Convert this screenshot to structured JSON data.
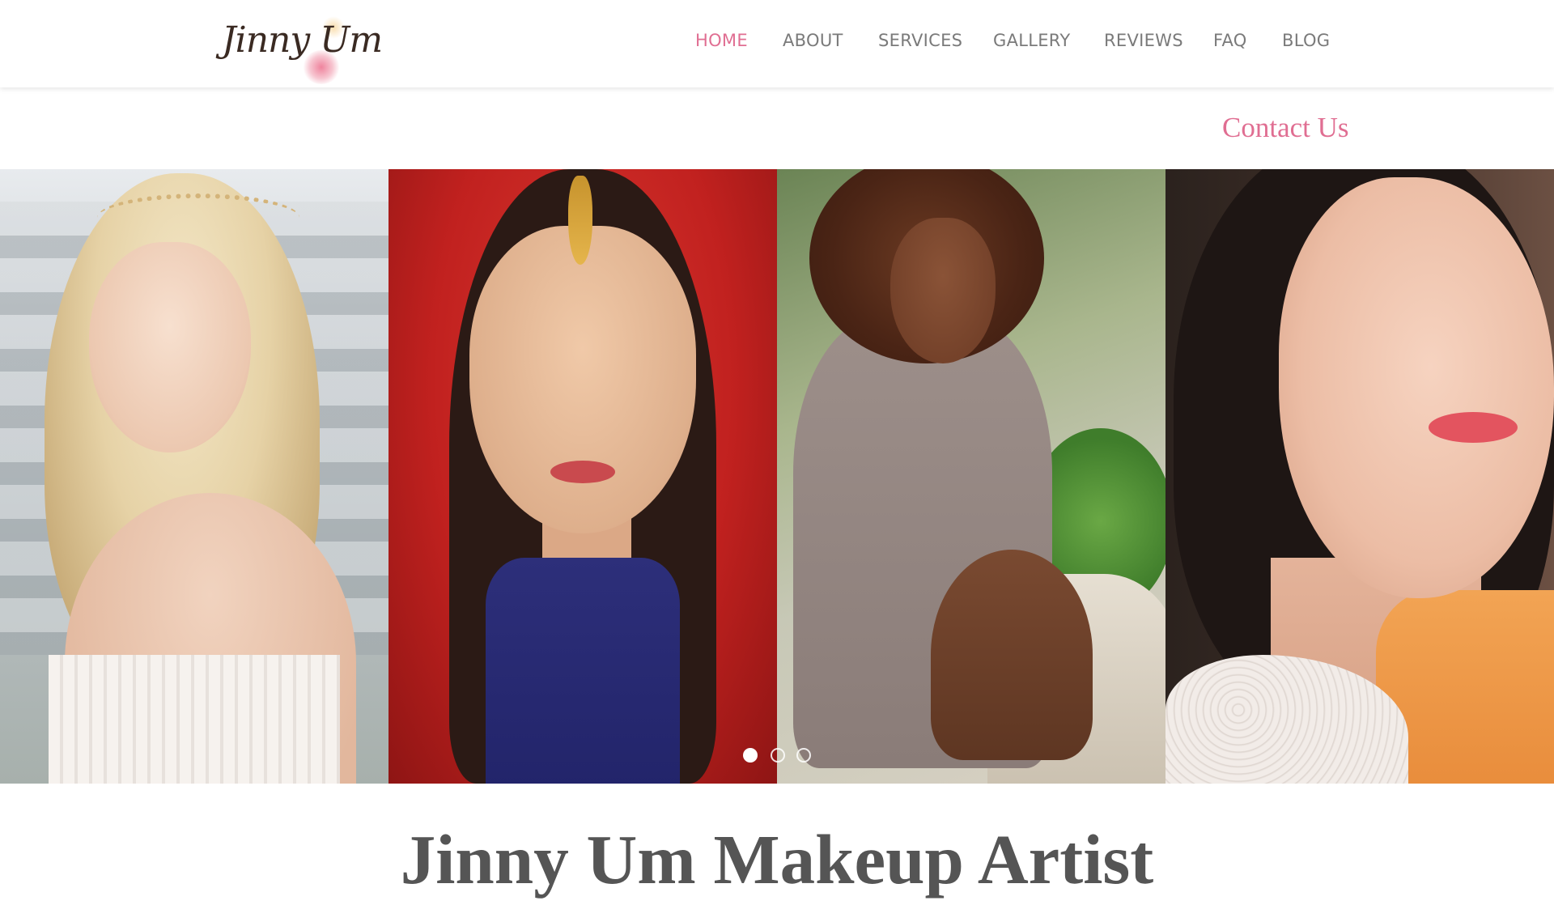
{
  "brand": {
    "logo_text": "Jinny Um"
  },
  "nav": {
    "items": [
      {
        "label": "HOME",
        "active": true
      },
      {
        "label": "ABOUT",
        "active": false
      },
      {
        "label": "SERVICES",
        "active": false
      },
      {
        "label": "GALLERY",
        "active": false
      },
      {
        "label": "REVIEWS",
        "active": false
      },
      {
        "label": "FAQ",
        "active": false
      },
      {
        "label": "BLOG",
        "active": false
      }
    ],
    "active_color": "#e06e92",
    "inactive_color": "#7a7a7a"
  },
  "contact": {
    "label": "Contact Us",
    "color": "#e06e92"
  },
  "slider": {
    "slides_visible": 4,
    "pager": {
      "count": 3,
      "active_index": 0
    }
  },
  "hero": {
    "title": "Jinny Um Makeup Artist",
    "color": "#555555"
  }
}
